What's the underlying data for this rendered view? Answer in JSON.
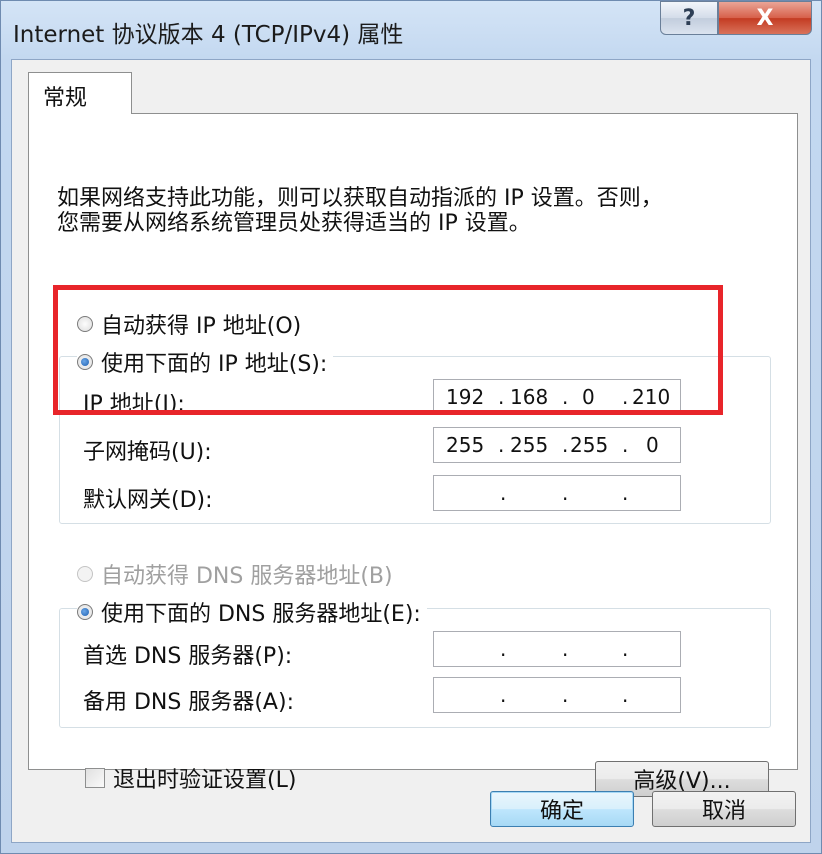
{
  "window": {
    "title": "Internet 协议版本 4 (TCP/IPv4) 属性",
    "help_label": "?",
    "close_label": "X"
  },
  "tab": {
    "label": "常规"
  },
  "description": {
    "line1": "如果网络支持此功能，则可以获取自动指派的 IP 设置。否则，",
    "line2": "您需要从网络系统管理员处获得适当的 IP 设置。"
  },
  "ip_section": {
    "auto_label": "自动获得 IP 地址(O)",
    "manual_label": "使用下面的 IP 地址(S):",
    "ip_label": "IP 地址(I):",
    "ip_value": [
      "192",
      "168",
      "0",
      "210"
    ],
    "subnet_label": "子网掩码(U):",
    "subnet_value": [
      "255",
      "255",
      "255",
      "0"
    ],
    "gateway_label": "默认网关(D):",
    "gateway_value": [
      "",
      "",
      "",
      ""
    ],
    "selected": "manual"
  },
  "dns_section": {
    "auto_label": "自动获得 DNS 服务器地址(B)",
    "auto_enabled": false,
    "manual_label": "使用下面的 DNS 服务器地址(E):",
    "preferred_label": "首选 DNS 服务器(P):",
    "alternate_label": "备用 DNS 服务器(A):",
    "selected": "manual"
  },
  "validate_checkbox": {
    "label": "退出时验证设置(L)",
    "checked": false
  },
  "buttons": {
    "advanced": "高级(V)...",
    "ok": "确定",
    "cancel": "取消"
  },
  "colors": {
    "highlight_box": "#e8252a"
  }
}
